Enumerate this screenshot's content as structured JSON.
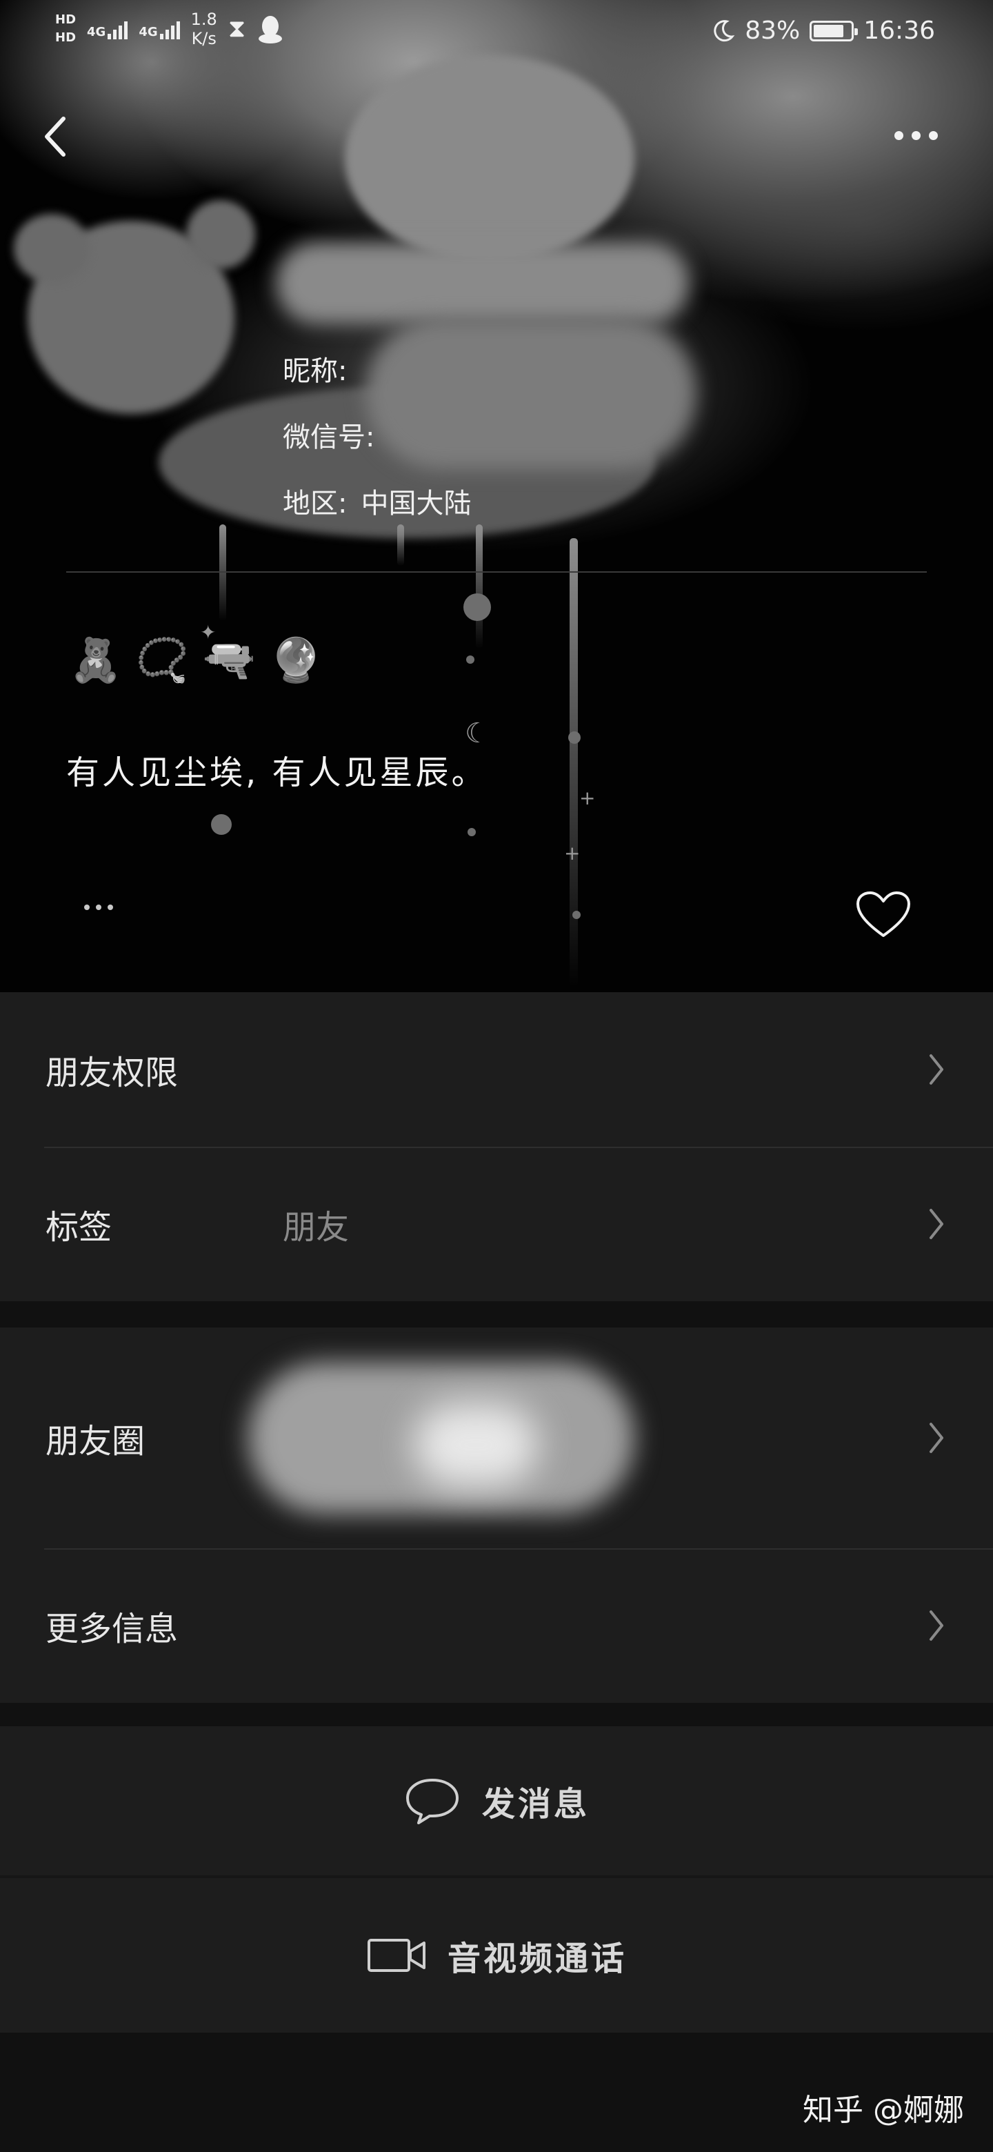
{
  "status_bar": {
    "hd1": "HD",
    "hd2": "HD",
    "net1": "4G",
    "net2": "4G",
    "speed_value": "1.8",
    "speed_unit": "K/s",
    "battery_percent": "83%",
    "battery_level": 0.83,
    "time": "16:36",
    "icons": [
      "hd-icon",
      "signal-icon",
      "hourglass-icon",
      "qq-icon",
      "moon-icon",
      "battery-icon"
    ]
  },
  "profile": {
    "nickname_label": "昵称:",
    "wechat_id_label": "微信号:",
    "region_label": "地区:",
    "region_value": "中国大陆",
    "emojis": "🧸 📿 🔫 🔮",
    "signature": "有人见尘埃, 有人见星辰。"
  },
  "settings_group": [
    {
      "label": "朋友权限",
      "value": ""
    },
    {
      "label": "标签",
      "value": "朋友"
    }
  ],
  "info_group": [
    {
      "label": "朋友圈",
      "value": ""
    },
    {
      "label": "更多信息",
      "value": ""
    }
  ],
  "actions": {
    "message_label": "发消息",
    "call_label": "音视频通话"
  },
  "watermark": "知乎 @婀娜"
}
